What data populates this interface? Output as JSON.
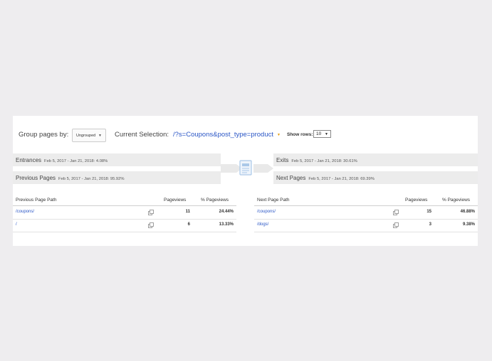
{
  "toolbar": {
    "group_label": "Group pages by:",
    "group_value": "Ungrouped",
    "selection_label": "Current Selection:",
    "selection_value": "/?s=Coupons&post_type=product",
    "show_rows_label": "Show rows:",
    "show_rows_value": "10"
  },
  "left": {
    "entrances": {
      "label": "Entrances",
      "meta": "Feb 5, 2017 - Jan 21, 2018: 4.08%"
    },
    "previous": {
      "label": "Previous Pages",
      "meta": "Feb 5, 2017 - Jan 21, 2018: 95.92%"
    },
    "table": {
      "headers": [
        "Previous Page Path",
        "Pageviews",
        "% Pageviews"
      ],
      "rows": [
        {
          "path": "/coupons/",
          "pageviews": "11",
          "pct": "24.44%"
        },
        {
          "path": "/",
          "pageviews": "6",
          "pct": "13.33%"
        }
      ]
    }
  },
  "right": {
    "exits": {
      "label": "Exits",
      "meta": "Feb 5, 2017 - Jan 21, 2018: 30.61%"
    },
    "next": {
      "label": "Next Pages",
      "meta": "Feb 5, 2017 - Jan 21, 2018: 69.39%"
    },
    "table": {
      "headers": [
        "Next Page Path",
        "Pageviews",
        "% Pageviews"
      ],
      "rows": [
        {
          "path": "/coupons/",
          "pageviews": "15",
          "pct": "46.88%"
        },
        {
          "path": "/dogs/",
          "pageviews": "3",
          "pct": "9.38%"
        }
      ]
    }
  },
  "colors": {
    "link": "#2a56c6",
    "strip": "#ececec",
    "accent_caret": "#e69b00"
  },
  "icons": {
    "center": "page-document-icon",
    "row": "external-link-icon"
  }
}
